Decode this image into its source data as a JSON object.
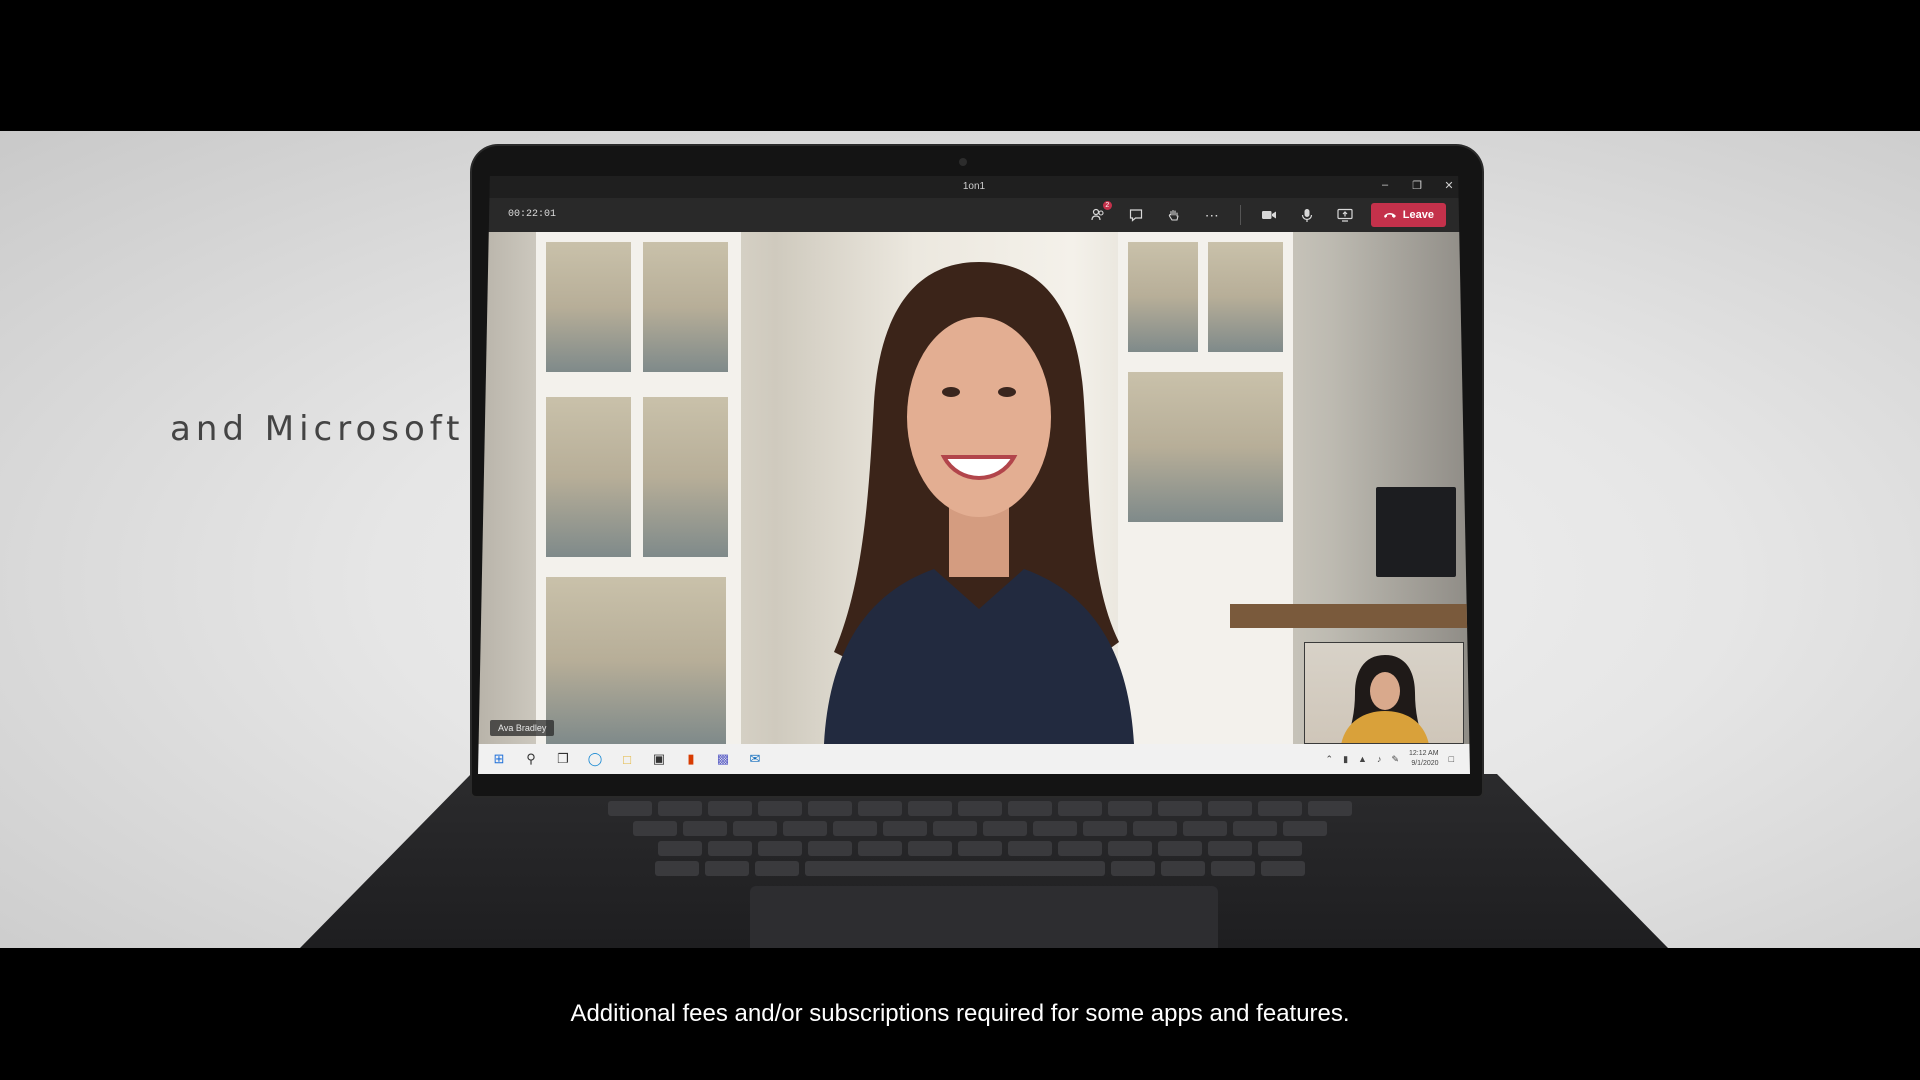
{
  "tagline": "and Microsoft",
  "caption": "Additional fees and/or subscriptions required for some apps and features.",
  "teams": {
    "window_title": "1on1",
    "call_timer": "00:22:01",
    "leave_label": "Leave",
    "participants_badge": "2",
    "participant_name": "Ava Bradley",
    "accent_color": "#c4314b"
  },
  "taskbar": {
    "clock_time": "12:12 AM",
    "clock_date": "9/1/2020"
  },
  "icons": {
    "participants": "people-icon",
    "chat": "chat-icon",
    "raise_hand": "hand-icon",
    "more": "more-icon",
    "camera": "video-camera-icon",
    "mic": "microphone-icon",
    "share": "share-screen-icon",
    "leave": "phone-hangup-icon"
  }
}
